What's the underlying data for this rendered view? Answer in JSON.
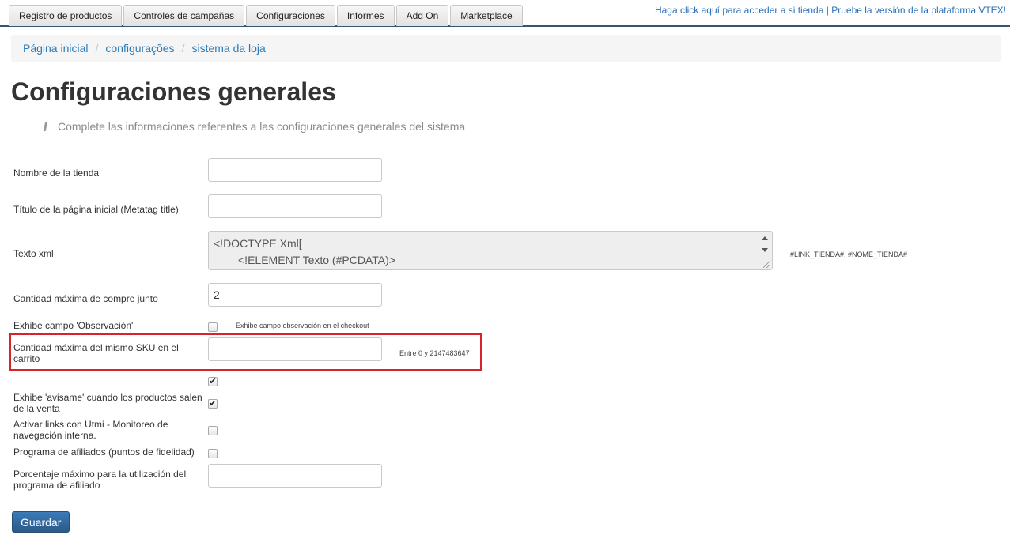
{
  "nav": {
    "tabs": [
      "Registro de productos",
      "Controles de campañas",
      "Configuraciones",
      "Informes",
      "Add On",
      "Marketplace"
    ],
    "store_link": "Haga click aquí para acceder a si tienda",
    "separator": "|",
    "vtex_link": "Pruebe la versión de la plataforma VTEX!"
  },
  "breadcrumb": [
    "Página inicial",
    "configurações",
    "sistema da loja"
  ],
  "breadcrumb_separator": "/",
  "page": {
    "title": "Configuraciones generales",
    "subtitle": "Complete las informaciones referentes a las configuraciones generales del sistema"
  },
  "form": {
    "store_name": {
      "label": "Nombre de la tienda",
      "value": ""
    },
    "home_title": {
      "label": "Título de la página inicial (Metatag title)",
      "value": ""
    },
    "xml_text": {
      "label": "Texto xml",
      "line1": "<!DOCTYPE Xml[",
      "line2": "<!ELEMENT Texto (#PCDATA)>",
      "hint": "#LINK_TIENDA#, #NOME_TIENDA#"
    },
    "buy_together": {
      "label": "Cantidad máxima de compre junto",
      "value": "2"
    },
    "observation": {
      "label": "Exhibe campo 'Observación'",
      "hint": "Exhibe campo observación en el checkout",
      "checked": false
    },
    "max_sku": {
      "label": "Cantidad máxima del mismo SKU en el carrito",
      "value": "",
      "hint": "Entre 0 y 2147483647"
    },
    "extra_checkbox": {
      "checked": true
    },
    "avisame": {
      "label": "Exhibe 'avisame' cuando los productos salen de la venta",
      "checked": true
    },
    "utmi": {
      "label": "Activar links con Utmi - Monitoreo de navegación interna.",
      "checked": false
    },
    "affiliates": {
      "label": "Programa de afiliados (puntos de fidelidad)",
      "checked": false
    },
    "affiliate_pct": {
      "label": "Porcentaje máximo para la utilización del programa de afiliado",
      "value": ""
    },
    "save_label": "Guardar"
  },
  "colors": {
    "accent": "#2b5a87",
    "link": "#2a6fb6",
    "highlight": "#d9232a"
  },
  "icons": [
    "checkmark-icon",
    "scroll-up-icon",
    "scroll-down-icon",
    "resize-grip-icon"
  ]
}
